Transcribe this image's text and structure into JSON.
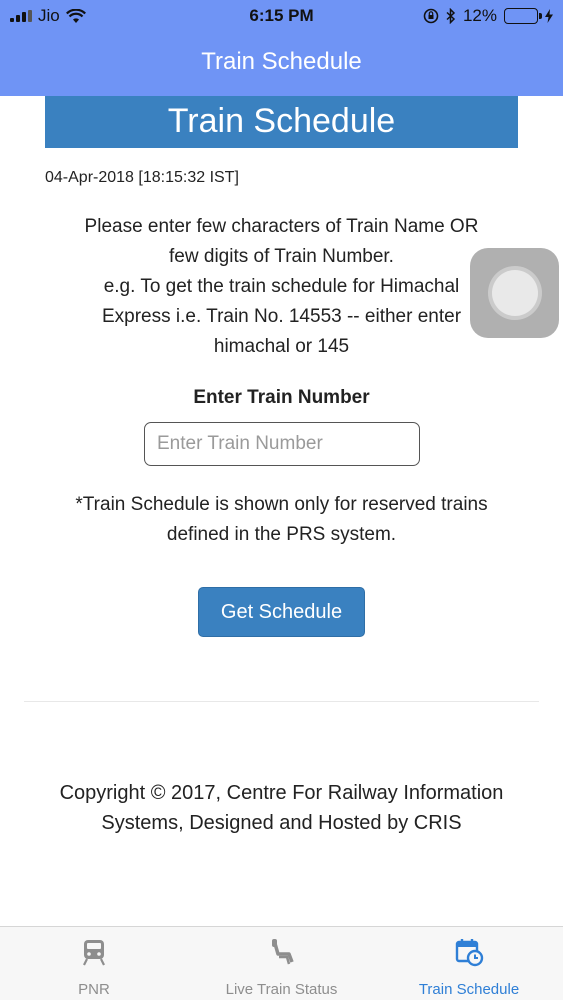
{
  "status_bar": {
    "carrier": "Jio",
    "time": "6:15 PM",
    "battery_percent": "12%"
  },
  "nav": {
    "title": "Train Schedule"
  },
  "banner": {
    "title": "Train Schedule"
  },
  "datetime": "04-Apr-2018 [18:15:32 IST]",
  "instructions": {
    "line1": "Please enter few characters of Train Name OR",
    "line2": "few digits of Train Number.",
    "line3": "e.g. To get the train schedule for Himachal",
    "line4": "Express i.e. Train No. 14553 -- either enter",
    "line5": "himachal or 145"
  },
  "form": {
    "label": "Enter Train Number",
    "placeholder": "Enter Train Number",
    "value": "",
    "button_label": "Get Schedule"
  },
  "note": {
    "line1": "*Train Schedule is shown only for reserved trains",
    "line2": "defined in the PRS system."
  },
  "copyright": {
    "line1": "Copyright © 2017, Centre For Railway Information",
    "line2": "Systems, Designed and Hosted by CRIS"
  },
  "tabs": [
    {
      "label": "PNR",
      "icon": "train-icon",
      "active": false
    },
    {
      "label": "Live Train Status",
      "icon": "seat-icon",
      "active": false
    },
    {
      "label": "Train Schedule",
      "icon": "calendar-clock-icon",
      "active": true
    }
  ],
  "colors": {
    "nav_bg": "#6f94f5",
    "banner_bg": "#3a81c0",
    "button_bg": "#3a81c0",
    "tab_active": "#2f7fd6",
    "tab_inactive": "#8e8e8e",
    "battery_low": "#e23a2e"
  }
}
